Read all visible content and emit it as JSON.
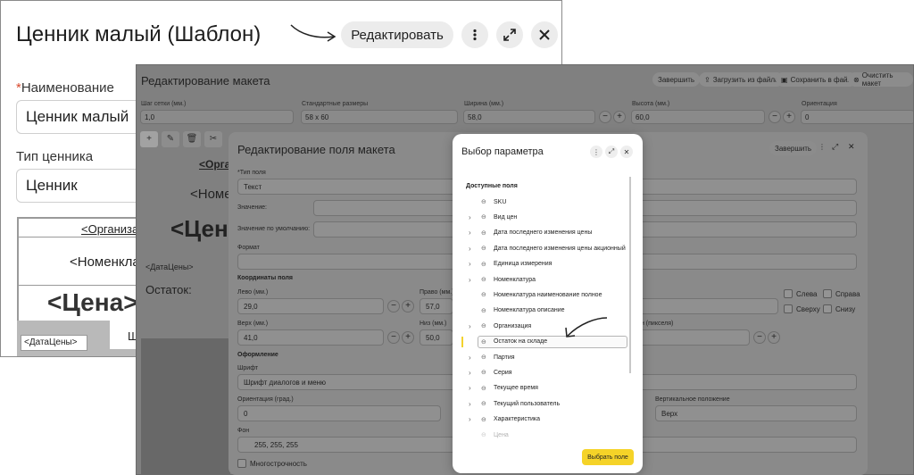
{
  "card": {
    "title": "Ценник малый (Шаблон)",
    "edit_label": "Редактировать",
    "name_label": "Наименование",
    "name_required_mark": "*",
    "name_value": "Ценник малый",
    "type_label": "Тип ценника",
    "type_value": "Ценник",
    "preview": {
      "org": "<Организа",
      "nom": "<Номенкла",
      "price": "<Цена>",
      "date": "<ДатаЦены>",
      "extra": "Ш"
    }
  },
  "editor": {
    "title": "Редактирование макета",
    "buttons": {
      "finish": "Завершить",
      "load": "Загрузить из файла",
      "save": "Сохранить в файл",
      "clear": "Очистить макет"
    },
    "grid_step_label": "Шаг сетки (мм.)",
    "grid_step_value": "1,0",
    "std_size_label": "Стандартные размеры",
    "std_size_value": "58 x 60",
    "width_label": "Ширина (мм.)",
    "width_value": "58,0",
    "height_label": "Высота (мм.)",
    "height_value": "60,0",
    "orient_label": "Ориентация",
    "orient_value": "0",
    "canvas": {
      "org": "<Орга",
      "nom": "<Номе",
      "price": "<Цен",
      "date": "<ДатаЦены>",
      "remain": "Остаток:"
    }
  },
  "field_dialog": {
    "title": "Редактирование поля макета",
    "finish": "Завершить",
    "field_type_label": "*Тип поля",
    "field_type_value": "Текст",
    "value_label": "Значение:",
    "default_label": "Значение по умолчанию:",
    "format_label": "Формат",
    "coords_section": "Координаты поля",
    "left_label": "Лево (мм.)",
    "left_value": "29,0",
    "right_label": "Право (мм.)",
    "right_value": "57,0",
    "top_label": "Верх (мм.)",
    "top_value": "41,0",
    "bottom_label": "Низ (мм.)",
    "bottom_value": "50,0",
    "pixels_label": "н (пикселя)",
    "chk_left": "Слева",
    "chk_right": "Справа",
    "chk_top": "Сверху",
    "chk_bottom": "Снизу",
    "design_section": "Оформление",
    "font_label": "Шрифт",
    "font_value": "Шрифт диалогов и меню",
    "orient_label": "Ориентация (град.)",
    "orient_value": "0",
    "v_align_label": "Вертикальное положение",
    "v_align_value": "Верх",
    "bg_label": "Фон",
    "bg_value": "255, 255, 255",
    "multiline_label": "Многострочность"
  },
  "picker": {
    "title": "Выбор параметра",
    "group_label": "Доступные поля",
    "items": [
      {
        "label": "SKU",
        "expandable": false
      },
      {
        "label": "Вид цен",
        "expandable": true
      },
      {
        "label": "Дата последнего изменения цены",
        "expandable": true
      },
      {
        "label": "Дата последнего изменения цены акционный",
        "expandable": true
      },
      {
        "label": "Единица измерения",
        "expandable": true
      },
      {
        "label": "Номенклатура",
        "expandable": true
      },
      {
        "label": "Номенклатура наименование полное",
        "expandable": false
      },
      {
        "label": "Номенклатура описание",
        "expandable": false
      },
      {
        "label": "Организация",
        "expandable": true
      },
      {
        "label": "Остаток на складе",
        "expandable": false
      },
      {
        "label": "Партия",
        "expandable": true
      },
      {
        "label": "Серия",
        "expandable": true
      },
      {
        "label": "Текущее время",
        "expandable": true
      },
      {
        "label": "Текущий пользователь",
        "expandable": true
      },
      {
        "label": "Характеристика",
        "expandable": true
      },
      {
        "label": "Цена",
        "expandable": false
      }
    ],
    "selected_index": 9,
    "choose_label": "Выбрать поле",
    "accent_color": "#f5d328"
  }
}
